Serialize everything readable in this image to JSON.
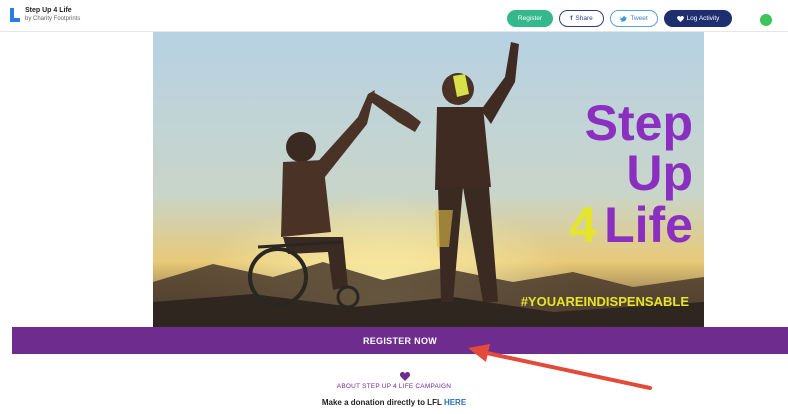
{
  "app": {
    "title": "Step Up 4 Life",
    "subtitle": "by Charity Footprints"
  },
  "toolbar": {
    "register_label": "Register",
    "share_label": "Share",
    "tweet_label": "Tweet",
    "log_label": "Log Activity"
  },
  "hero": {
    "line1": "Step",
    "line2": "Up",
    "line3_num": "4",
    "line3_word": "Life",
    "hashtag": "#YOUAREINDISPENSABLE"
  },
  "band": {
    "label": "REGISTER NOW"
  },
  "about": {
    "label": "ABOUT STEP UP 4 LIFE CAMPAIGN"
  },
  "donate": {
    "text": "Make a donation directly to LFL",
    "link": "HERE"
  },
  "colors": {
    "brand_purple": "#6e2d8e",
    "register_green": "#35b88b",
    "navy": "#1d2f6f",
    "step_purple": "#8a2fbf",
    "yellow": "#e5e52b",
    "arrow_red": "#e24b3c"
  },
  "icons": [
    "logo-icon",
    "facebook-icon",
    "twitter-icon",
    "heart-icon",
    "whatsapp-icon",
    "more-icon",
    "arrow-annotation"
  ]
}
